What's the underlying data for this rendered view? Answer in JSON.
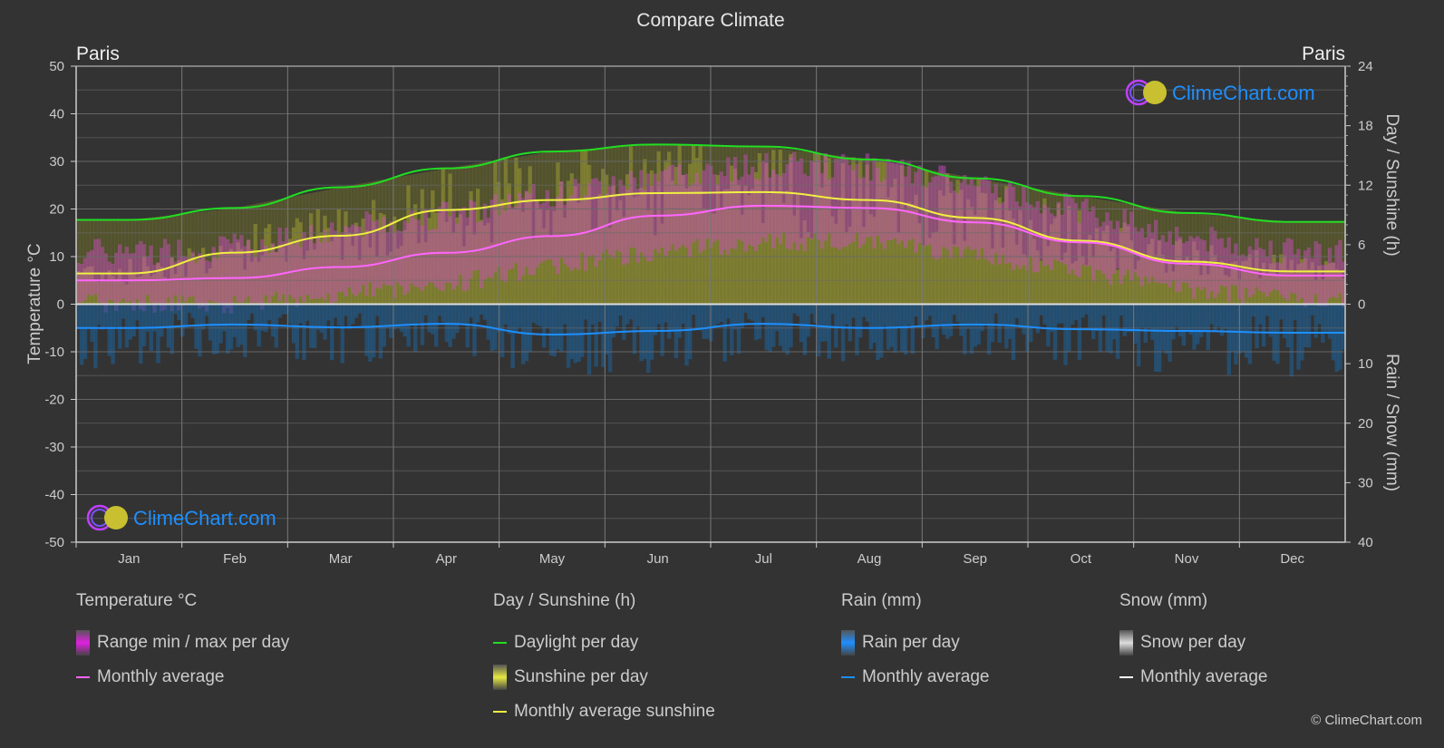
{
  "title": "Compare Climate",
  "location_left": "Paris",
  "location_right": "Paris",
  "watermark": "ClimeChart.com",
  "copyright": "© ClimeChart.com",
  "colors": {
    "background": "#333333",
    "grid": "#5a5a5a",
    "temp_avg": "#ff66ff",
    "temp_range": "#e020e0",
    "daylight": "#22dd22",
    "sunshine_avg": "#f0f040",
    "sunshine_bar": "#a0a030",
    "rain_avg": "#1e8fff",
    "rain_bar": "#1f6aa5",
    "snow_avg": "#ffffff",
    "watermark": "#1e8fff"
  },
  "chart_data": {
    "type": "line",
    "title": "Compare Climate",
    "categories": [
      "Jan",
      "Feb",
      "Mar",
      "Apr",
      "May",
      "Jun",
      "Jul",
      "Aug",
      "Sep",
      "Oct",
      "Nov",
      "Dec"
    ],
    "y_left": {
      "label": "Temperature °C",
      "range": [
        -50,
        50
      ],
      "ticks": [
        "50",
        "40",
        "30",
        "20",
        "10",
        "0",
        "-10",
        "-20",
        "-30",
        "-40",
        "-50"
      ]
    },
    "y_right_top": {
      "label": "Day / Sunshine (h)",
      "range": [
        0,
        24
      ],
      "ticks": [
        "24",
        "18",
        "12",
        "6",
        "0"
      ]
    },
    "y_right_bottom": {
      "label": "Rain / Snow (mm)",
      "range": [
        0,
        40
      ],
      "ticks": [
        "0",
        "10",
        "20",
        "30",
        "40"
      ]
    },
    "grid": true,
    "series": [
      {
        "name": "Temperature monthly average",
        "axis": "temp",
        "values": [
          5.0,
          5.5,
          7.8,
          10.8,
          14.3,
          18.6,
          20.7,
          20.2,
          17.2,
          13.0,
          8.5,
          6.0
        ]
      },
      {
        "name": "Daylight per day",
        "axis": "hours",
        "values": [
          8.5,
          9.7,
          11.8,
          13.7,
          15.4,
          16.1,
          15.9,
          14.6,
          12.7,
          10.9,
          9.2,
          8.3
        ]
      },
      {
        "name": "Monthly average sunshine",
        "axis": "hours",
        "values": [
          3.1,
          5.2,
          6.9,
          9.5,
          10.5,
          11.2,
          11.3,
          10.5,
          8.7,
          6.4,
          4.3,
          3.3
        ]
      },
      {
        "name": "Rain monthly average",
        "axis": "mm",
        "values": [
          4.0,
          3.4,
          3.9,
          3.3,
          5.1,
          4.5,
          3.3,
          4.0,
          3.4,
          4.2,
          4.5,
          4.8
        ]
      },
      {
        "name": "Snow monthly average",
        "axis": "mm",
        "values": [
          0,
          0,
          0,
          0,
          0,
          0,
          0,
          0,
          0,
          0,
          0,
          0
        ]
      }
    ],
    "temp_range_approx": {
      "min": [
        2,
        2,
        4,
        6,
        10,
        13,
        15,
        15,
        12,
        9,
        5,
        3
      ],
      "max": [
        8,
        9,
        13,
        16,
        20,
        24,
        26,
        26,
        22,
        17,
        11,
        8
      ]
    }
  },
  "legend": [
    {
      "heading": "Temperature °C",
      "items": [
        {
          "kind": "box",
          "label": "Range min / max per day",
          "color": "#e020e0"
        },
        {
          "kind": "line",
          "label": "Monthly average",
          "color": "#ff66ff"
        }
      ]
    },
    {
      "heading": "Day / Sunshine (h)",
      "items": [
        {
          "kind": "line",
          "label": "Daylight per day",
          "color": "#22dd22"
        },
        {
          "kind": "box",
          "label": "Sunshine per day",
          "color": "#e8e840"
        },
        {
          "kind": "line",
          "label": "Monthly average sunshine",
          "color": "#f0f040"
        }
      ]
    },
    {
      "heading": "Rain (mm)",
      "items": [
        {
          "kind": "box",
          "label": "Rain per day",
          "color": "#1e8fff"
        },
        {
          "kind": "line",
          "label": "Monthly average",
          "color": "#1e8fff"
        }
      ]
    },
    {
      "heading": "Snow (mm)",
      "items": [
        {
          "kind": "box",
          "label": "Snow per day",
          "color": "#dddddd"
        },
        {
          "kind": "line",
          "label": "Monthly average",
          "color": "#ffffff"
        }
      ]
    }
  ]
}
